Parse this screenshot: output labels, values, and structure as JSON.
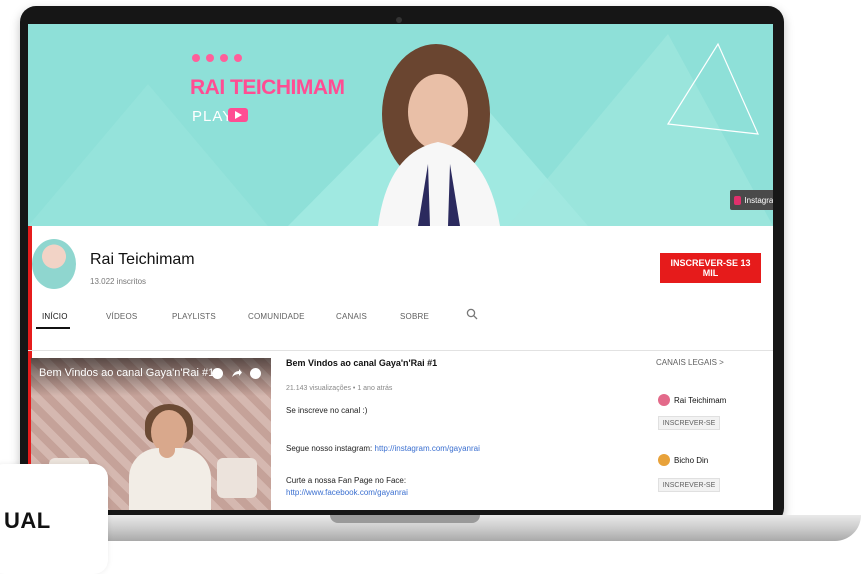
{
  "banner": {
    "brand_name": "RAI TEICHIMAM",
    "brand_sub": "PLAY",
    "instagram_label": "Instagram",
    "colors": {
      "background": "#8ee0d8",
      "accent": "#ff4d93"
    }
  },
  "channel": {
    "name": "Rai Teichimam",
    "subscribers": "13.022 inscritos",
    "subscribe_label": "INSCREVER-SE 13 MIL",
    "subscribe_color": "#e61b1b"
  },
  "tabs": [
    {
      "label": "INÍCIO",
      "active": true
    },
    {
      "label": "VÍDEOS"
    },
    {
      "label": "PLAYLISTS"
    },
    {
      "label": "COMUNIDADE"
    },
    {
      "label": "CANAIS"
    },
    {
      "label": "SOBRE"
    }
  ],
  "featured_video": {
    "overlay_title": "Bem Vindos ao canal Gaya'n'Rai #1",
    "title": "Bem Vindos ao canal Gaya'n'Rai #1",
    "meta": "21.143 visualizações • 1 ano atrás",
    "lines": [
      "Se inscreve no canal :)",
      "Segue nosso instagram: ",
      "Curte a nossa Fan Page no Face:"
    ],
    "instagram_link": "http://instagram.com/gayanrai",
    "facebook_link": "http://www.facebook.com/gayanrai"
  },
  "sidebar": {
    "heading": "CANAIS LEGAIS >",
    "channels": [
      {
        "name": "Rai Teichimam",
        "button": "INSCREVER-SE",
        "color": "#e36a8a"
      },
      {
        "name": "Bicho Din",
        "button": "INSCREVER-SE",
        "color": "#e8a23a"
      }
    ]
  },
  "overlay": {
    "text": "UAL"
  }
}
